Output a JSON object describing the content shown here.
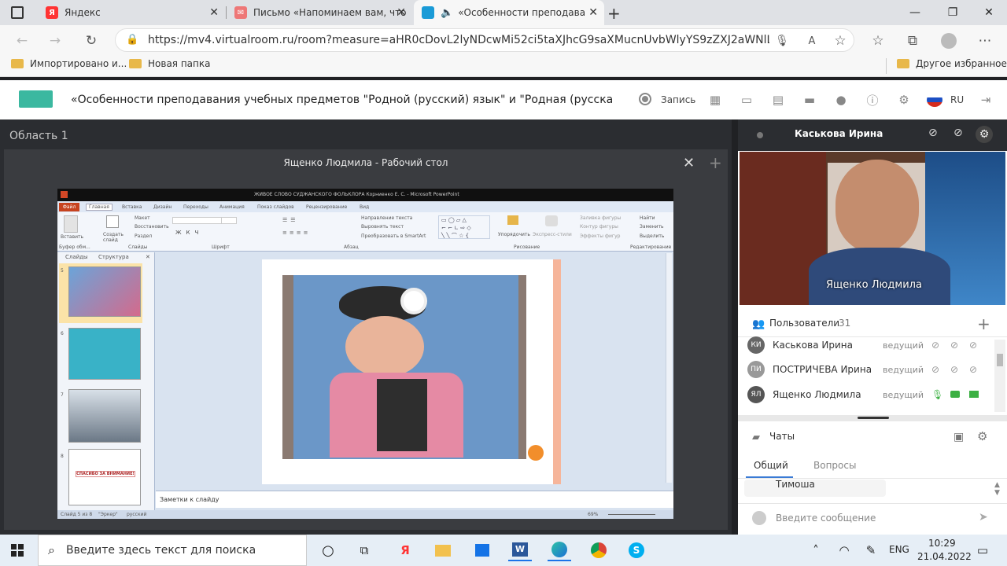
{
  "browser": {
    "tabs": [
      {
        "label": "Яндекс",
        "fav": "Я",
        "color": "#f33"
      },
      {
        "label": "Письмо «Напоминаем вам, что",
        "fav": "✉",
        "color": "#e77"
      },
      {
        "label": "«Особенности преподава",
        "fav": "",
        "color": "#1a9bd7"
      }
    ],
    "url": "https://mv4.virtualroom.ru/room?measure=aHR0cDovL2lyNDcwMi52ci5taXJhcG9saXMucnUvbWlyYS9zZXJ2aWNlL3YyX25DZ...",
    "bookmarks": [
      "Импортировано и...",
      "Новая папка"
    ],
    "other_bookmarks": "Другое избранное"
  },
  "app": {
    "title": "«Особенности преподавания учебных предметов \"Родной (русский) язык\" и \"Родная (русская) литера...",
    "record_label": "Запись",
    "lang": "RU"
  },
  "main": {
    "area_label": "Область 1",
    "screen_title": "Ященко Людмила - Рабочий стол"
  },
  "ppt": {
    "window_title": "ЖИВОЕ СЛОВО СУДЖАНСКОГО ФОЛЬКЛОРА Корниенко Е. С. - Microsoft PowerPoint",
    "ribbon_tabs": [
      "Файл",
      "Главная",
      "Вставка",
      "Дизайн",
      "Переходы",
      "Анимация",
      "Показ слайдов",
      "Рецензирование",
      "Вид"
    ],
    "groups": [
      "Буфер обм...",
      "Слайды",
      "Шрифт",
      "Абзац",
      "Рисование",
      "Редактирование"
    ],
    "ribbon_buttons": [
      "Вставить",
      "Создать слайд",
      "Макет",
      "Восстановить",
      "Раздел",
      "Направление текста",
      "Выровнять текст",
      "Преобразовать в SmartArt",
      "Упорядочить",
      "Экспресс-стили",
      "Заливка фигуры",
      "Контур фигуры",
      "Эффекты фигур",
      "Найти",
      "Заменить",
      "Выделить"
    ],
    "panel_tabs": [
      "Слайды",
      "Структура"
    ],
    "thumb_numbers": [
      "5",
      "6",
      "7",
      "8"
    ],
    "thumb8_text": "СПАСИБО ЗА ВНИМАНИЕ!",
    "notes": "Заметки к слайду",
    "status": [
      "Слайд 5 из 8",
      "\"Эркер\"",
      "русский"
    ],
    "zoom": "69%"
  },
  "panel": {
    "host_name": "Каськова Ирина",
    "video_label": "Ященко Людмила",
    "users_label": "Пользователи",
    "users_count": "31",
    "users": [
      {
        "initials": "КИ",
        "name": "Каськова Ирина",
        "role": "ведущий"
      },
      {
        "initials": "ПИ",
        "name": "ПОСТРИЧЕВА Ирина",
        "role": "ведущий"
      },
      {
        "initials": "ЯЛ",
        "name": "Ященко Людмила",
        "role": "ведущий"
      }
    ],
    "chats_label": "Чаты",
    "chat_tabs": [
      "Общий",
      "Вопросы"
    ],
    "chat_message_author": "Тимоша",
    "chat_input_placeholder": "Введите сообщение"
  },
  "taskbar": {
    "search_placeholder": "Введите здесь текст для поиска",
    "lang": "ENG",
    "time": "10:29",
    "date": "21.04.2022"
  }
}
